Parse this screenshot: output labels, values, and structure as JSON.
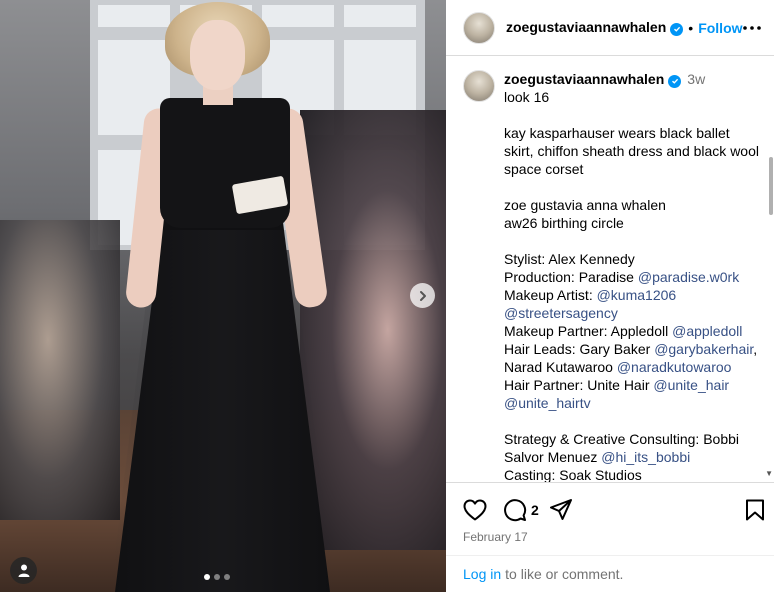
{
  "header": {
    "username": "zoegustaviaannawhalen",
    "separator": "•",
    "follow_label": "Follow"
  },
  "caption": {
    "username": "zoegustaviaannawhalen",
    "time": "3w",
    "lines": [
      "look 16",
      "",
      "kay kasparhauser wears black ballet skirt, chiffon sheath dress and black wool space corset",
      "",
      "zoe gustavia anna whalen",
      "aw26 birthing circle",
      "",
      "Stylist: Alex Kennedy"
    ],
    "credits": {
      "production_label": "Production: Paradise",
      "production_handle": "@paradise.w0rk",
      "makeup_label": "Makeup Artist:",
      "makeup_handle": "@kuma1206",
      "makeup_agency": "@streetersagency",
      "makeup_partner_label": "Makeup Partner: Appledoll",
      "makeup_partner_handle": "@appledoll",
      "hair_leads_label": "Hair Leads: Gary Baker",
      "hair_leads_handle1": "@garybakerhair",
      "hair_leads_name2": "Narad Kutawaroo",
      "hair_leads_handle2": "@naradkutowaroo",
      "hair_partner_label": "Hair Partner: Unite Hair",
      "hair_partner_handle": "@unite_hair",
      "hair_partner_handle2": "@unite_hairtv",
      "strategy_line1": "Strategy & Creative Consulting: Bobbi",
      "strategy_line2": "Salvor Menuez",
      "strategy_handle": "@hi_its_bobbi",
      "casting": "Casting: Soak Studios"
    }
  },
  "actions": {
    "comment_count": "2",
    "date": "February 17"
  },
  "login": {
    "link_label": "Log in",
    "rest": "to like or comment."
  },
  "carousel": {
    "slide_count": 3,
    "active_index": 0
  },
  "colors": {
    "link_blue": "#0095f6",
    "mention_blue": "#385185",
    "muted_gray": "#737373",
    "border": "#dbdbdb"
  }
}
